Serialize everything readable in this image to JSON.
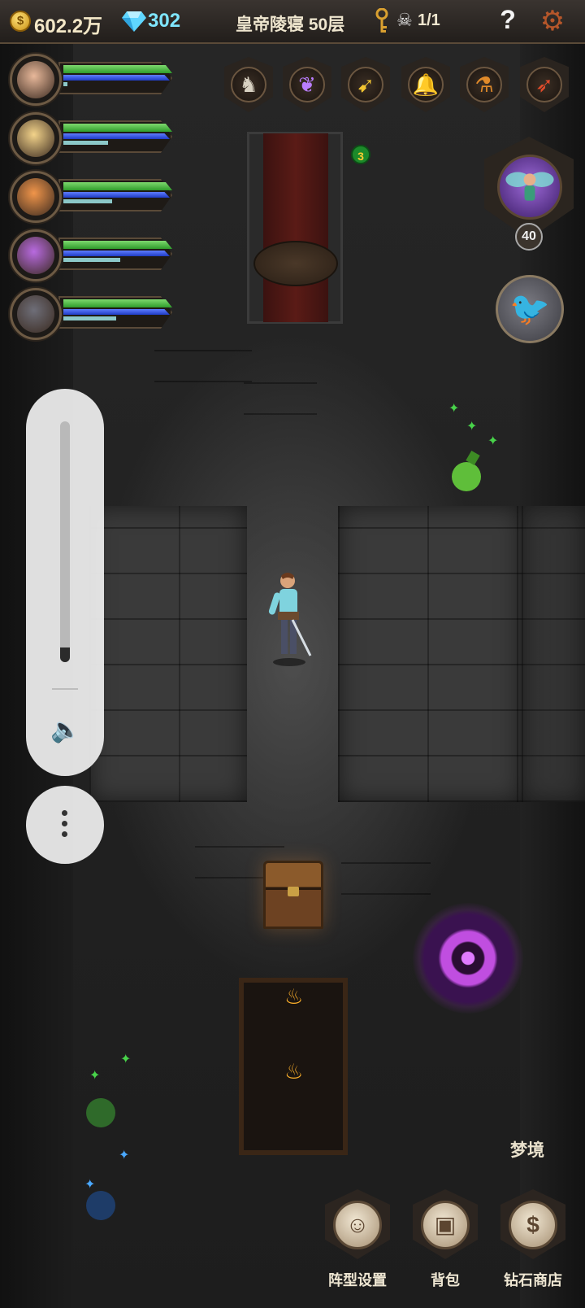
{
  "topbar": {
    "gold": "602.2万",
    "coin_symbol": "$",
    "gems": "302",
    "floor_title": "皇帝陵寝 50层",
    "kills": "1/1",
    "help_symbol": "?",
    "settings_icon": "gear-icon"
  },
  "heroes": [
    {
      "name": "hero-1",
      "hp": 1.0,
      "mp": 1.0,
      "xp": 0.05,
      "color": "#e8b89a"
    },
    {
      "name": "hero-2",
      "hp": 1.0,
      "mp": 1.0,
      "xp": 0.55,
      "color": "#f3d38a"
    },
    {
      "name": "hero-3",
      "hp": 1.0,
      "mp": 1.0,
      "xp": 0.6,
      "color": "#f0954a"
    },
    {
      "name": "hero-4",
      "hp": 1.0,
      "mp": 1.0,
      "xp": 0.7,
      "color": "#b86ae0"
    },
    {
      "name": "hero-5",
      "hp": 1.0,
      "mp": 1.0,
      "xp": 0.65,
      "color": "#6e6e78"
    }
  ],
  "skills": [
    {
      "icon": "horse-head-icon",
      "glyph": "♞",
      "color": "#d9d2c3"
    },
    {
      "icon": "purple-dragon-icon",
      "glyph": "❦",
      "color": "#b97dff"
    },
    {
      "icon": "golden-feather-icon",
      "glyph": "➹",
      "color": "#f2c531"
    },
    {
      "icon": "bell-icon",
      "glyph": "🔔",
      "color": "#d7a64a"
    },
    {
      "icon": "potion-flask-icon",
      "glyph": "⚗",
      "color": "#e08a2a"
    },
    {
      "icon": "carrot-icon",
      "glyph": "➶",
      "color": "#e24b2b"
    }
  ],
  "map": {
    "badge_number": "3"
  },
  "pet": {
    "level": "40"
  },
  "volume": {
    "level": 0.06
  },
  "bottom": {
    "dream_label": "梦境",
    "menu": [
      {
        "label": "阵型设置",
        "icon": "formation-icon",
        "glyph": "☺"
      },
      {
        "label": "背包",
        "icon": "backpack-icon",
        "glyph": "▣"
      },
      {
        "label": "钻石商店",
        "icon": "diamond-shop-icon",
        "glyph": "$"
      }
    ]
  }
}
